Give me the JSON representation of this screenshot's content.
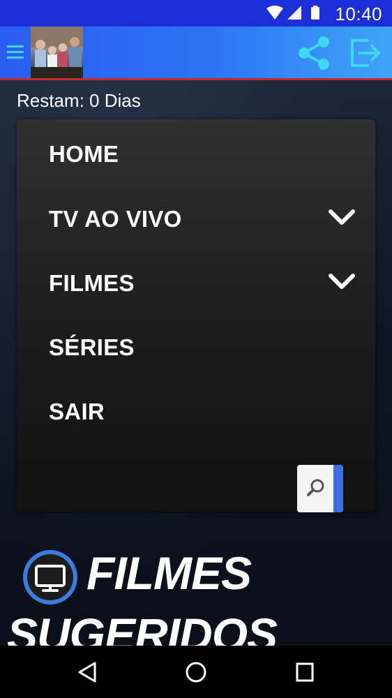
{
  "status_bar": {
    "time": "10:40"
  },
  "header": {
    "icons": {
      "menu": "hamburger-icon",
      "share": "share-icon",
      "exit": "exit-icon"
    },
    "accent": "#3fd8f0",
    "divider_color": "#c62828"
  },
  "main": {
    "remaining_text": "Restam: 0 Dias",
    "menu": {
      "items": [
        {
          "label": "HOME"
        },
        {
          "label": "TV AO VIVO",
          "expandable": true
        },
        {
          "label": "FILMES",
          "expandable": true
        },
        {
          "label": "SÉRIES"
        },
        {
          "label": "SAIR"
        }
      ]
    },
    "search_icon": "search-icon",
    "suggested": {
      "line1": "FILMES",
      "line2": "SUGERIDOS",
      "icon": "tv-icon"
    }
  },
  "nav_bar": {
    "icons": [
      "back-icon",
      "home-icon",
      "recents-icon"
    ]
  }
}
